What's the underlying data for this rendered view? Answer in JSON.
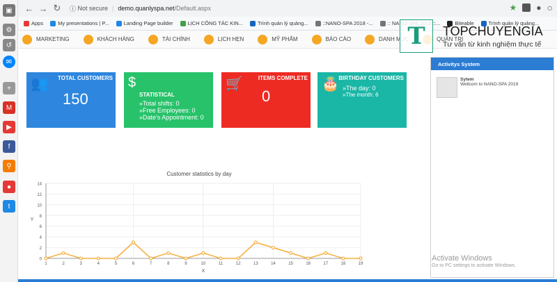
{
  "browser": {
    "url_security": "Not secure",
    "url_host": "demo.quanlyspa.net",
    "url_path": "/Default.aspx"
  },
  "bookmarks": [
    {
      "label": "Apps",
      "color": "#e53935"
    },
    {
      "label": "My presentations | P...",
      "color": "#1e88e5"
    },
    {
      "label": "Landing Page builder",
      "color": "#1e88e5"
    },
    {
      "label": "LỊCH CÔNG TÁC KIN...",
      "color": "#43a047"
    },
    {
      "label": "Trình quản lý quảng...",
      "color": "#1565c0"
    },
    {
      "label": "::NANO-SPA 2018 -...",
      "color": "#757575"
    },
    {
      "label": ":: NANO-SPA 2018 ::...",
      "color": "#757575"
    },
    {
      "label": "Biteable",
      "color": "#212121"
    },
    {
      "label": "Trình quản lý quảng...",
      "color": "#1565c0"
    }
  ],
  "menu": [
    {
      "label": "MARKETING"
    },
    {
      "label": "KHÁCH HÀNG"
    },
    {
      "label": "TÀI CHÍNH"
    },
    {
      "label": "LỊCH HẸN"
    },
    {
      "label": "MỸ PHẨM"
    },
    {
      "label": "BÁO CÁO"
    },
    {
      "label": "DANH MỤC"
    },
    {
      "label": "QUẢN TRỊ"
    }
  ],
  "cards": {
    "customers": {
      "title": "TOTAL CUSTOMERS",
      "value": "150",
      "color": "#2e86de"
    },
    "statistical": {
      "title": "STATISTICAL",
      "lines": [
        "»Total shifts: 0",
        "»Free Employees: 0",
        "»Date's Appointment: 0"
      ],
      "color": "#27c26a"
    },
    "items": {
      "title": "ITEMS COMPLETE",
      "value": "0",
      "color": "#ee2b23"
    },
    "birthday": {
      "title": "BIRTHDAY CUSTOMERS",
      "day": "»The day: 0",
      "month": "»The month: 6",
      "color": "#1ab6a6"
    }
  },
  "chart_data": {
    "type": "line",
    "title": "Customer statistics by day",
    "xlabel": "X",
    "ylabel": "Y",
    "x": [
      1,
      2,
      3,
      4,
      5,
      6,
      7,
      8,
      9,
      10,
      11,
      12,
      13,
      14,
      15,
      16,
      17,
      18,
      19
    ],
    "values": [
      0,
      1,
      0,
      0,
      0,
      3,
      0,
      1,
      0,
      1,
      0,
      0,
      3,
      2,
      1,
      0,
      1,
      0,
      0
    ],
    "yticks": [
      0,
      2,
      4,
      6,
      8,
      10,
      12,
      14
    ],
    "ylim": [
      0,
      14
    ],
    "grid": true,
    "line_color": "#f5b041"
  },
  "activity": {
    "header": "Activitys System",
    "item_user": "Sytem",
    "item_text": "Wellcom to NANO-SPA 2019"
  },
  "watermark": {
    "title": "Activate Windows",
    "subtitle": "Go to PC settings to activate Windows."
  },
  "logo": {
    "letter": "T",
    "title": "TOPCHUYENGIA",
    "subtitle": "Tư vấn từ kinh nghiệm thực tế"
  }
}
